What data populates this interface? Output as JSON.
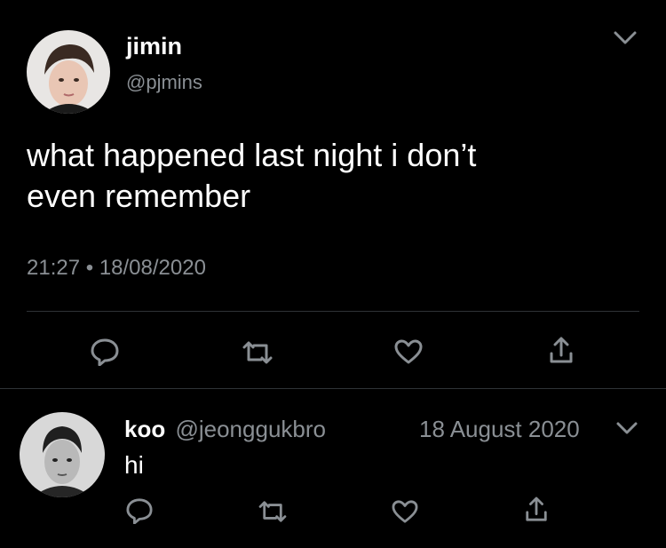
{
  "main_tweet": {
    "author_name": "jimin",
    "author_handle": "@pjmins",
    "text_line1": "what happened last night i don’t",
    "text_line2": "even remember",
    "time": "21:27",
    "date": "18/08/2020",
    "separator": "•"
  },
  "reply": {
    "author_name": "koo",
    "author_handle": "@jeonggukbro",
    "date": "18 August 2020",
    "text": "hi"
  },
  "icons": {
    "menu": "chevron-down-icon",
    "reply": "reply-icon",
    "retweet": "retweet-icon",
    "like": "heart-icon",
    "share": "share-icon"
  },
  "colors": {
    "background": "#000000",
    "text": "#ffffff",
    "muted": "#8a8f94",
    "divider": "#2f3336"
  }
}
